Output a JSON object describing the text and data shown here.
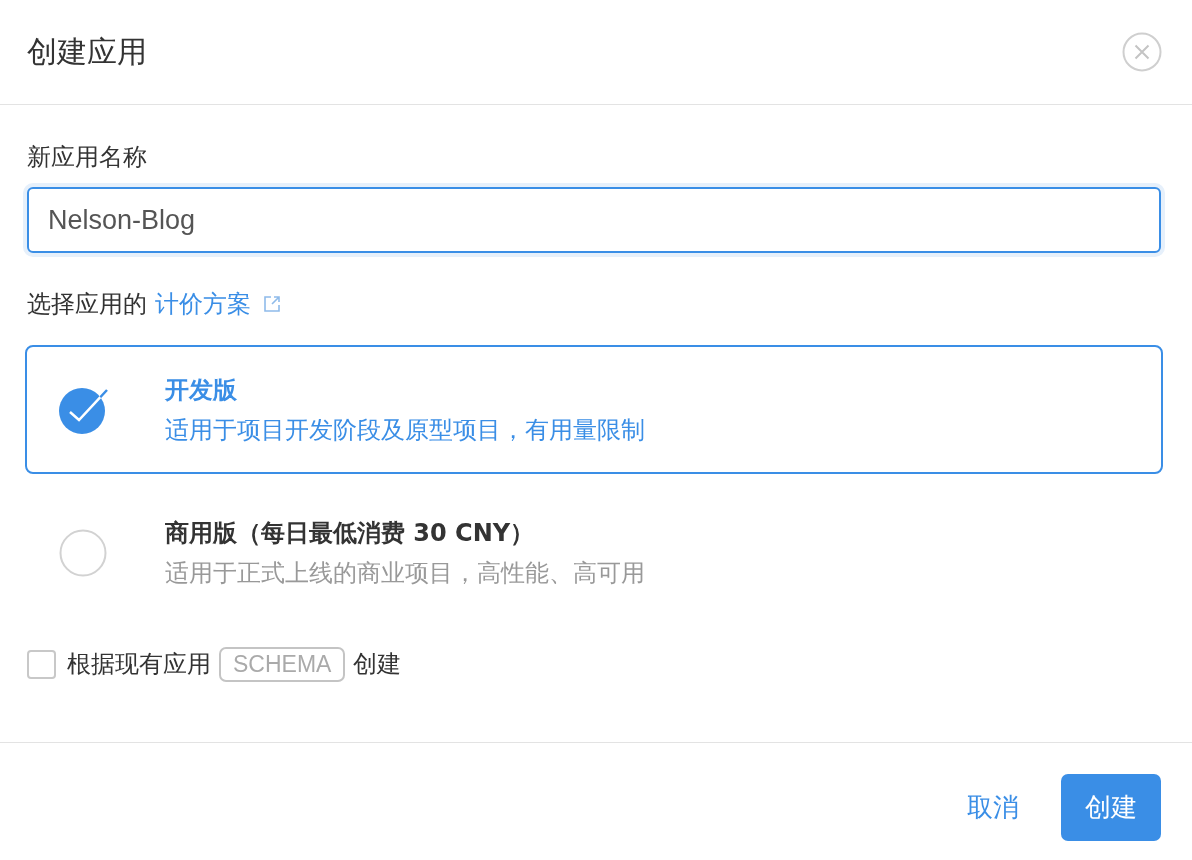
{
  "dialog": {
    "title": "创建应用"
  },
  "name_field": {
    "label": "新应用名称",
    "value": "Nelson-Blog",
    "focused": true
  },
  "pricing": {
    "label": "选择应用的",
    "link": "计价方案"
  },
  "plans": [
    {
      "title": "开发版",
      "description": "适用于项目开发阶段及原型项目，有用量限制",
      "selected": true
    },
    {
      "title": "商用版（每日最低消费 30 CNY）",
      "description": "适用于正式上线的商业项目，高性能、高可用",
      "selected": false
    }
  ],
  "schema_option": {
    "checked": false,
    "label_before": "根据现有应用",
    "tag": "SCHEMA",
    "label_after": "创建"
  },
  "buttons": [
    {
      "label": "取消",
      "kind": "link"
    },
    {
      "label": "创建",
      "kind": "primary"
    }
  ]
}
